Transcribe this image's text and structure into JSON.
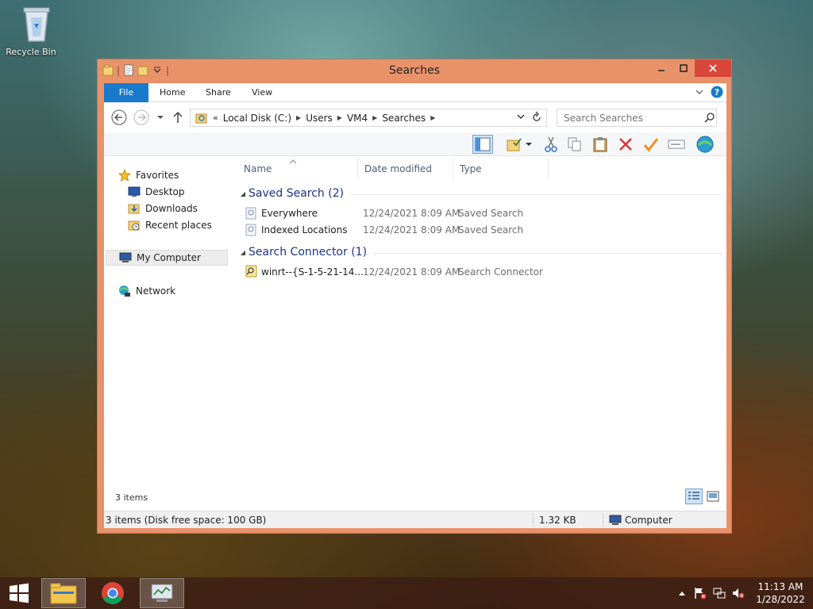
{
  "desktop": {
    "recycle_bin_label": "Recycle Bin"
  },
  "window": {
    "title": "Searches",
    "ribbon_tabs": [
      "File",
      "Home",
      "Share",
      "View"
    ],
    "address": {
      "prefix": "«",
      "crumbs": [
        "Local Disk (C:)",
        "Users",
        "VM4",
        "Searches"
      ]
    },
    "search": {
      "placeholder": "Search Searches"
    },
    "columns": [
      "Name",
      "Date modified",
      "Type"
    ],
    "nav": {
      "favorites": "Favorites",
      "desktop": "Desktop",
      "downloads": "Downloads",
      "recent": "Recent places",
      "my_computer": "My Computer",
      "network": "Network"
    },
    "groups": [
      {
        "title": "Saved Search (2)",
        "items": [
          {
            "name": "Everywhere",
            "date": "12/24/2021 8:09 AM",
            "type": "Saved Search"
          },
          {
            "name": "Indexed Locations",
            "date": "12/24/2021 8:09 AM",
            "type": "Saved Search"
          }
        ]
      },
      {
        "title": "Search Connector (1)",
        "items": [
          {
            "name": "winrt--{S-1-5-21-14...",
            "date": "12/24/2021 8:09 AM",
            "type": "Search Connector"
          }
        ]
      }
    ],
    "item_count": "3 items",
    "status": {
      "left": "3 items (Disk free space: 100 GB)",
      "size": "1.32 KB",
      "location": "Computer"
    }
  },
  "taskbar": {
    "time": "11:13 AM",
    "date": "1/28/2022"
  },
  "colors": {
    "window_frame": "#e9926a",
    "file_tab": "#1979ca",
    "close_button": "#d9473a",
    "group_title": "#1e3287"
  }
}
